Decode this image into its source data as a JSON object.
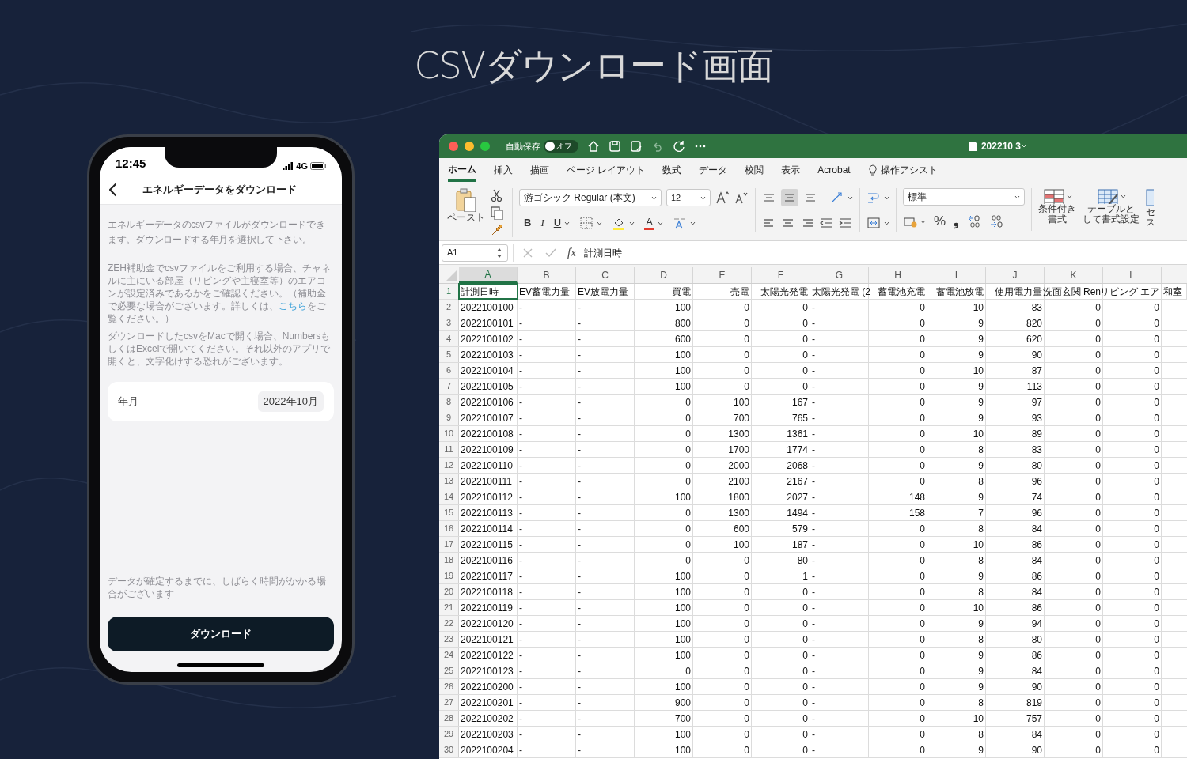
{
  "title": "CSVダウンロード画面",
  "phone": {
    "time": "12:45",
    "network": "4G",
    "nav_title": "エネルギーデータをダウンロード",
    "intro": "エネルギーデータのcsvファイルがダウンロードできます。ダウンロードする年月を選択して下さい。",
    "note_1_before": "ZEH補助金でcsvファイルをご利用する場合、チャネルに主にいる部屋（リビングや主寝室等）のエアコンが設定済みであるかをご確認ください。（補助金で必要な場合がございます。詳しくは、",
    "note_1_link": "こちら",
    "note_1_after": "をご覧ください。）",
    "note_2": "ダウンロードしたcsvをMacで開く場合、NumbersもしくはExcelで開いてください。それ以外のアプリで開くと、文字化けする恐れがございます。",
    "month_label": "年月",
    "month_value": "2022年10月",
    "footer_note": "データが確定するまでに、しばらく時間がかかる場合がございます",
    "download_button": "ダウンロード"
  },
  "excel": {
    "autosave_label": "自動保存",
    "autosave_state": "オフ",
    "autosave_on": false,
    "file_name": "202210 3",
    "tabs": [
      {
        "label": "ホーム",
        "selected": true
      },
      {
        "label": "挿入",
        "selected": false
      },
      {
        "label": "描画",
        "selected": false
      },
      {
        "label": "ページ レイアウト",
        "selected": false
      },
      {
        "label": "数式",
        "selected": false
      },
      {
        "label": "データ",
        "selected": false
      },
      {
        "label": "校閲",
        "selected": false
      },
      {
        "label": "表示",
        "selected": false
      },
      {
        "label": "Acrobat",
        "selected": false
      },
      {
        "label": "操作アシスト",
        "selected": false
      }
    ],
    "paste_label": "ペースト",
    "font_name": "游ゴシック Regular (本文)",
    "font_size": "12",
    "bold": "B",
    "italic": "I",
    "underline": "U",
    "font_color": "A",
    "percent": "%",
    "comma": "❟",
    "number_format": "標準",
    "align_center_selected": true,
    "cond_format_label": [
      "条件付き",
      "書式"
    ],
    "table_format_label": [
      "テーブルと",
      "して書式設定"
    ],
    "cell_style_label": [
      "セ",
      "ス"
    ],
    "name_box": "A1",
    "fx": "fx",
    "formula": "計測日時",
    "columns": [
      {
        "letter": "A",
        "selected": true
      },
      {
        "letter": "B",
        "selected": false
      },
      {
        "letter": "C",
        "selected": false
      },
      {
        "letter": "D",
        "selected": false
      },
      {
        "letter": "E",
        "selected": false
      },
      {
        "letter": "F",
        "selected": false
      },
      {
        "letter": "G",
        "selected": false
      },
      {
        "letter": "H",
        "selected": false
      },
      {
        "letter": "I",
        "selected": false
      },
      {
        "letter": "J",
        "selected": false
      },
      {
        "letter": "K",
        "selected": false
      },
      {
        "letter": "L",
        "selected": false
      }
    ],
    "rows": [
      {
        "number": "1",
        "selected": true,
        "cells": [
          "計測日時",
          "EV蓄電力量",
          "EV放電力量",
          "買電",
          "売電",
          "太陽光発電",
          "太陽光発電 (2",
          "蓄電池充電",
          "蓄電池放電",
          "使用電力量",
          "洗面玄関 Ren",
          "リビング エア",
          "和室"
        ]
      },
      {
        "number": "2",
        "selected": false,
        "cells": [
          "2022100100",
          "-",
          "-",
          "100",
          "0",
          "0",
          "-",
          "0",
          "10",
          "83",
          "0",
          "0"
        ]
      },
      {
        "number": "3",
        "selected": false,
        "cells": [
          "2022100101",
          "-",
          "-",
          "800",
          "0",
          "0",
          "-",
          "0",
          "9",
          "820",
          "0",
          "0"
        ]
      },
      {
        "number": "4",
        "selected": false,
        "cells": [
          "2022100102",
          "-",
          "-",
          "600",
          "0",
          "0",
          "-",
          "0",
          "9",
          "620",
          "0",
          "0"
        ]
      },
      {
        "number": "5",
        "selected": false,
        "cells": [
          "2022100103",
          "-",
          "-",
          "100",
          "0",
          "0",
          "-",
          "0",
          "9",
          "90",
          "0",
          "0"
        ]
      },
      {
        "number": "6",
        "selected": false,
        "cells": [
          "2022100104",
          "-",
          "-",
          "100",
          "0",
          "0",
          "-",
          "0",
          "10",
          "87",
          "0",
          "0"
        ]
      },
      {
        "number": "7",
        "selected": false,
        "cells": [
          "2022100105",
          "-",
          "-",
          "100",
          "0",
          "0",
          "-",
          "0",
          "9",
          "113",
          "0",
          "0"
        ]
      },
      {
        "number": "8",
        "selected": false,
        "cells": [
          "2022100106",
          "-",
          "-",
          "0",
          "100",
          "167",
          "-",
          "0",
          "9",
          "97",
          "0",
          "0"
        ]
      },
      {
        "number": "9",
        "selected": false,
        "cells": [
          "2022100107",
          "-",
          "-",
          "0",
          "700",
          "765",
          "-",
          "0",
          "9",
          "93",
          "0",
          "0"
        ]
      },
      {
        "number": "10",
        "selected": false,
        "cells": [
          "2022100108",
          "-",
          "-",
          "0",
          "1300",
          "1361",
          "-",
          "0",
          "10",
          "89",
          "0",
          "0"
        ]
      },
      {
        "number": "11",
        "selected": false,
        "cells": [
          "2022100109",
          "-",
          "-",
          "0",
          "1700",
          "1774",
          "-",
          "0",
          "8",
          "83",
          "0",
          "0"
        ]
      },
      {
        "number": "12",
        "selected": false,
        "cells": [
          "2022100110",
          "-",
          "-",
          "0",
          "2000",
          "2068",
          "-",
          "0",
          "9",
          "80",
          "0",
          "0"
        ]
      },
      {
        "number": "13",
        "selected": false,
        "cells": [
          "2022100111",
          "-",
          "-",
          "0",
          "2100",
          "2167",
          "-",
          "0",
          "8",
          "96",
          "0",
          "0"
        ]
      },
      {
        "number": "14",
        "selected": false,
        "cells": [
          "2022100112",
          "-",
          "-",
          "100",
          "1800",
          "2027",
          "-",
          "148",
          "9",
          "74",
          "0",
          "0"
        ]
      },
      {
        "number": "15",
        "selected": false,
        "cells": [
          "2022100113",
          "-",
          "-",
          "0",
          "1300",
          "1494",
          "-",
          "158",
          "7",
          "96",
          "0",
          "0"
        ]
      },
      {
        "number": "16",
        "selected": false,
        "cells": [
          "2022100114",
          "-",
          "-",
          "0",
          "600",
          "579",
          "-",
          "0",
          "8",
          "84",
          "0",
          "0"
        ]
      },
      {
        "number": "17",
        "selected": false,
        "cells": [
          "2022100115",
          "-",
          "-",
          "0",
          "100",
          "187",
          "-",
          "0",
          "10",
          "86",
          "0",
          "0"
        ]
      },
      {
        "number": "18",
        "selected": false,
        "cells": [
          "2022100116",
          "-",
          "-",
          "0",
          "0",
          "80",
          "-",
          "0",
          "8",
          "84",
          "0",
          "0"
        ]
      },
      {
        "number": "19",
        "selected": false,
        "cells": [
          "2022100117",
          "-",
          "-",
          "100",
          "0",
          "1",
          "-",
          "0",
          "9",
          "86",
          "0",
          "0"
        ]
      },
      {
        "number": "20",
        "selected": false,
        "cells": [
          "2022100118",
          "-",
          "-",
          "100",
          "0",
          "0",
          "-",
          "0",
          "8",
          "84",
          "0",
          "0"
        ]
      },
      {
        "number": "21",
        "selected": false,
        "cells": [
          "2022100119",
          "-",
          "-",
          "100",
          "0",
          "0",
          "-",
          "0",
          "10",
          "86",
          "0",
          "0"
        ]
      },
      {
        "number": "22",
        "selected": false,
        "cells": [
          "2022100120",
          "-",
          "-",
          "100",
          "0",
          "0",
          "-",
          "0",
          "9",
          "94",
          "0",
          "0"
        ]
      },
      {
        "number": "23",
        "selected": false,
        "cells": [
          "2022100121",
          "-",
          "-",
          "100",
          "0",
          "0",
          "-",
          "0",
          "8",
          "80",
          "0",
          "0"
        ]
      },
      {
        "number": "24",
        "selected": false,
        "cells": [
          "2022100122",
          "-",
          "-",
          "100",
          "0",
          "0",
          "-",
          "0",
          "9",
          "86",
          "0",
          "0"
        ]
      },
      {
        "number": "25",
        "selected": false,
        "cells": [
          "2022100123",
          "-",
          "-",
          "0",
          "0",
          "0",
          "-",
          "0",
          "9",
          "84",
          "0",
          "0"
        ]
      },
      {
        "number": "26",
        "selected": false,
        "cells": [
          "2022100200",
          "-",
          "-",
          "100",
          "0",
          "0",
          "-",
          "0",
          "9",
          "90",
          "0",
          "0"
        ]
      },
      {
        "number": "27",
        "selected": false,
        "cells": [
          "2022100201",
          "-",
          "-",
          "900",
          "0",
          "0",
          "-",
          "0",
          "8",
          "819",
          "0",
          "0"
        ]
      },
      {
        "number": "28",
        "selected": false,
        "cells": [
          "2022100202",
          "-",
          "-",
          "700",
          "0",
          "0",
          "-",
          "0",
          "10",
          "757",
          "0",
          "0"
        ]
      },
      {
        "number": "29",
        "selected": false,
        "cells": [
          "2022100203",
          "-",
          "-",
          "100",
          "0",
          "0",
          "-",
          "0",
          "8",
          "84",
          "0",
          "0"
        ]
      },
      {
        "number": "30",
        "selected": false,
        "cells": [
          "2022100204",
          "-",
          "-",
          "100",
          "0",
          "0",
          "-",
          "0",
          "9",
          "90",
          "0",
          "0"
        ]
      }
    ]
  }
}
